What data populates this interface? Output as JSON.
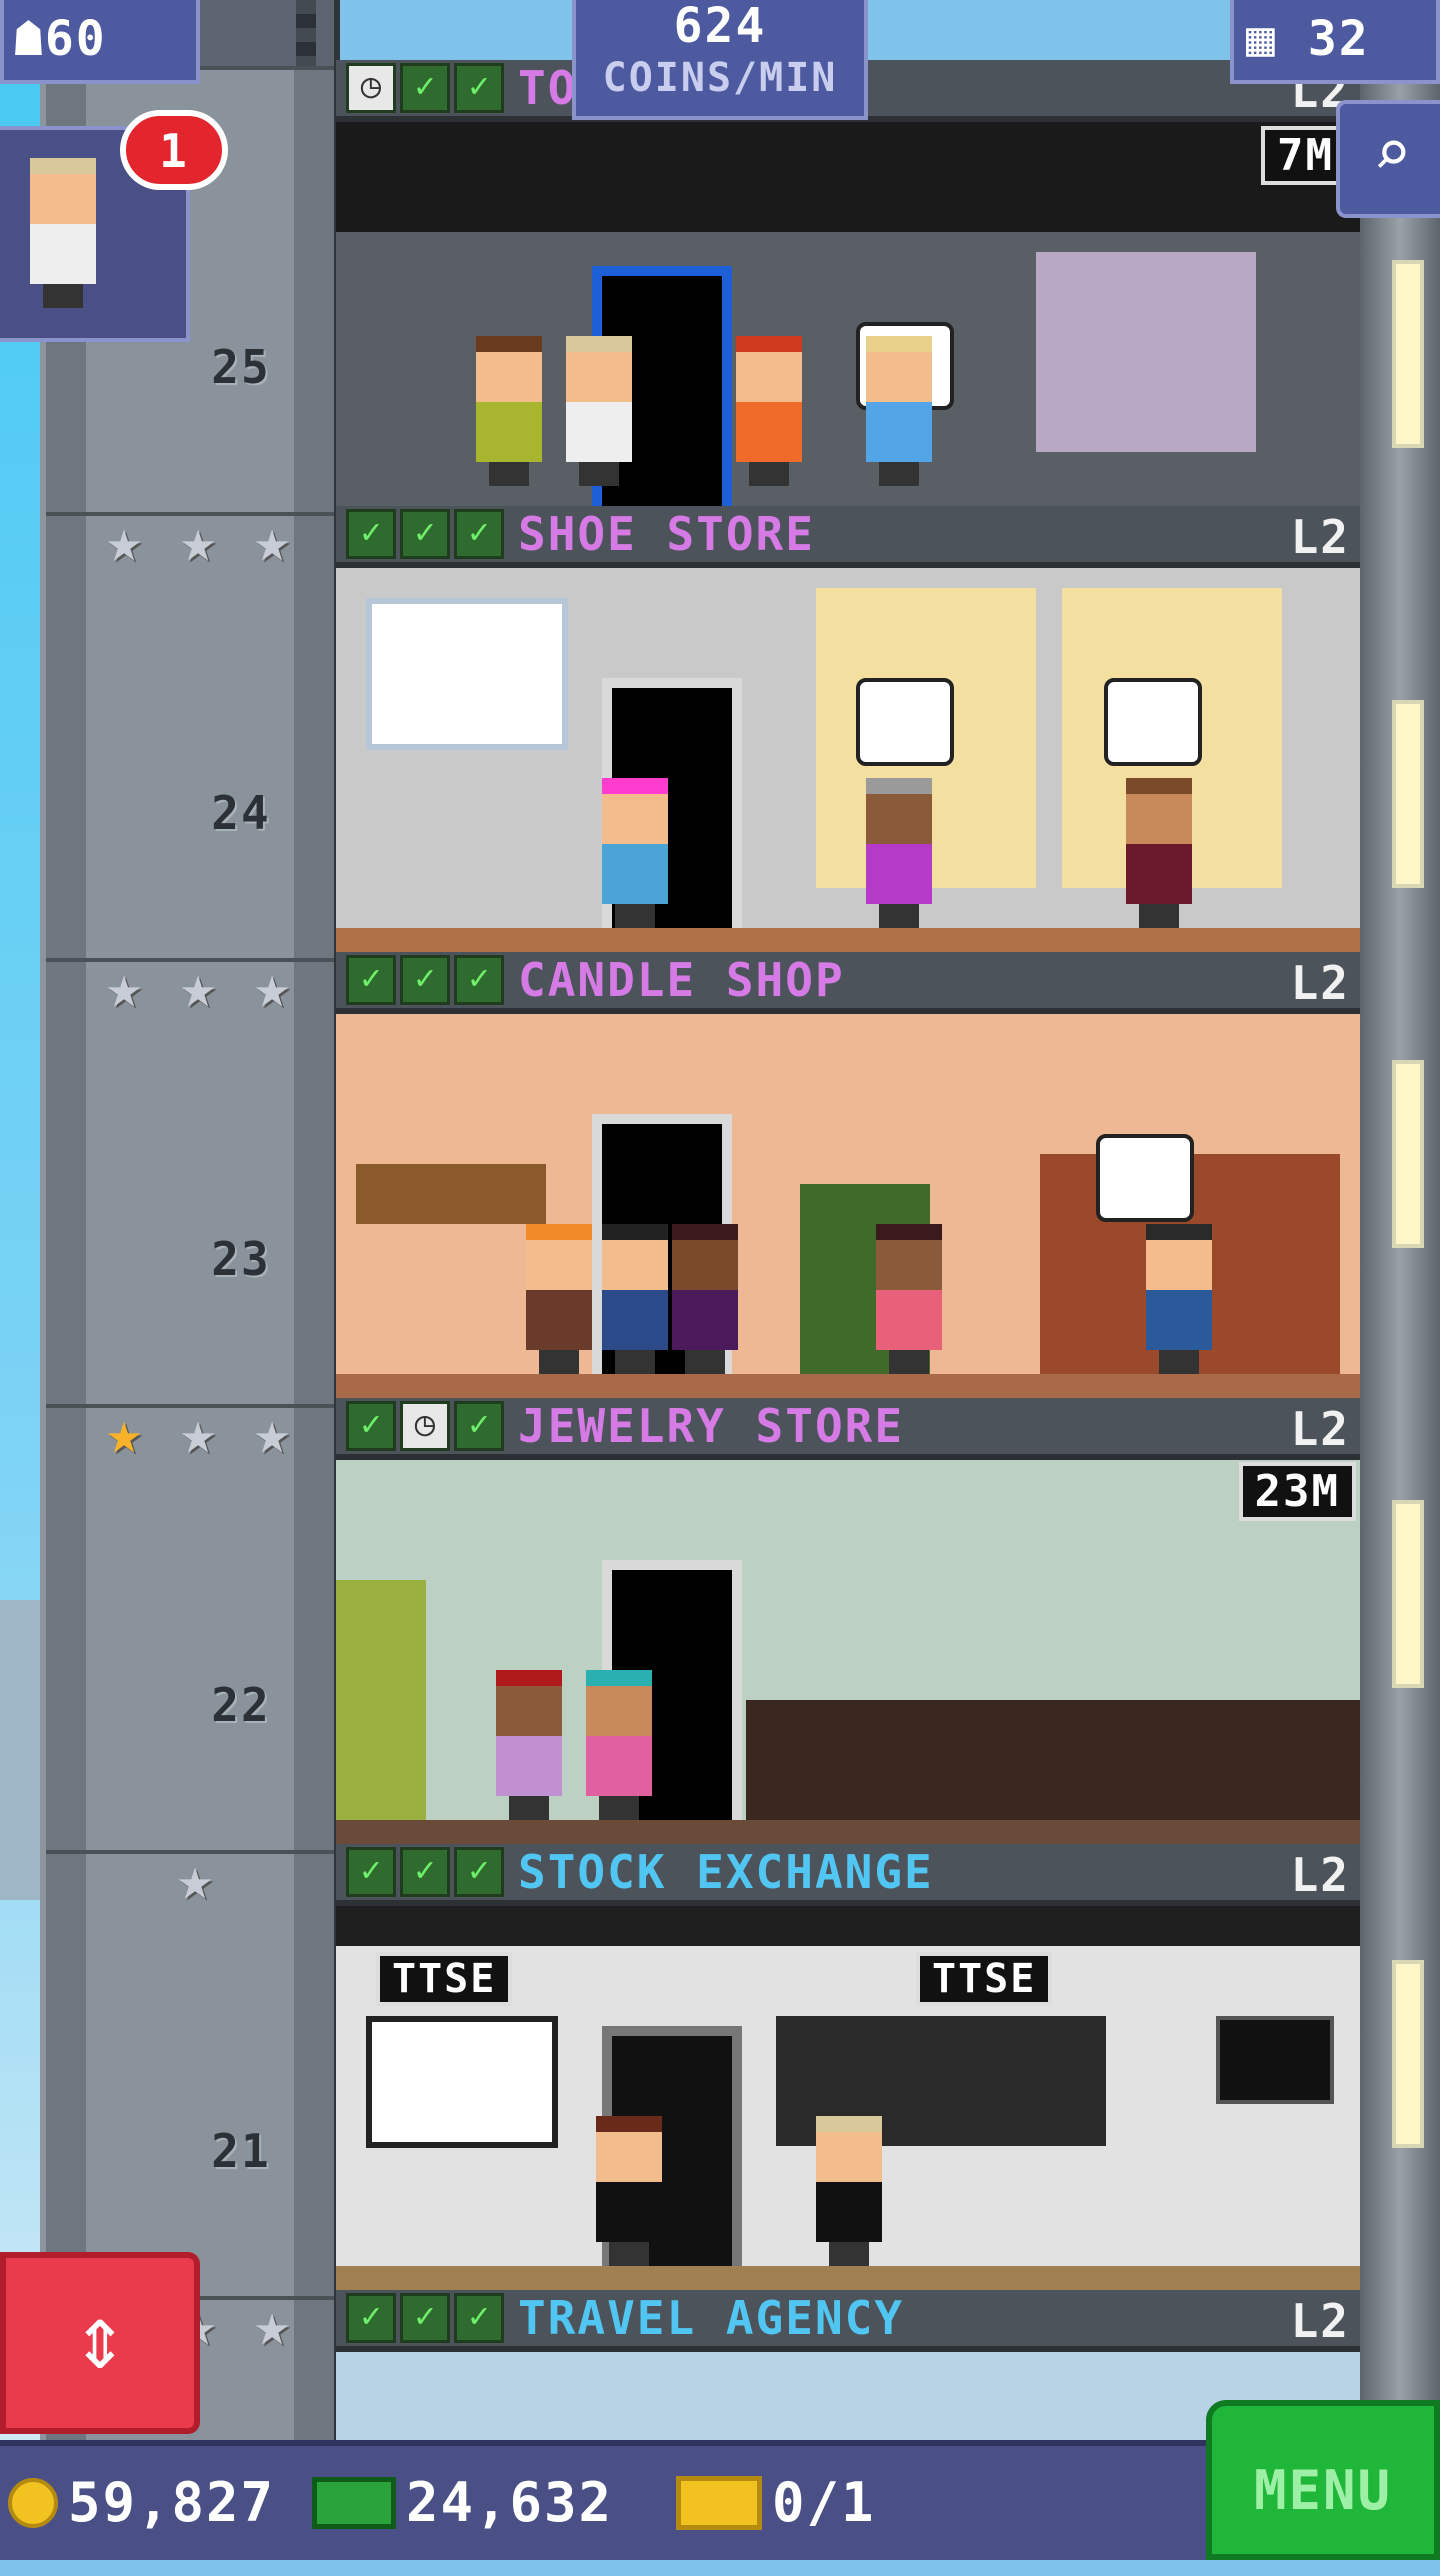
{
  "hud": {
    "population": "60",
    "coins_per_min_value": "624",
    "coins_per_min_label": "COINS/MIN",
    "floors": "32",
    "search_icon": "magnifier-icon"
  },
  "visitor": {
    "notification_count": "1"
  },
  "top_floor": {
    "name": "TO    AP",
    "level": "L2",
    "inventory_badge": "7M"
  },
  "floors": [
    {
      "number": "25",
      "name": "SHOE STORE",
      "level": "L2",
      "name_color": "#d67ae6",
      "stars": [
        "silver",
        "silver",
        "silver"
      ],
      "checks": [
        "check",
        "check",
        "check"
      ]
    },
    {
      "number": "24",
      "name": "CANDLE SHOP",
      "level": "L2",
      "name_color": "#d67ae6",
      "stars": [
        "silver",
        "silver",
        "silver"
      ],
      "checks": [
        "check",
        "check",
        "check"
      ]
    },
    {
      "number": "23",
      "name": "JEWELRY STORE",
      "level": "L2",
      "name_color": "#d67ae6",
      "stars": [
        "gold",
        "silver",
        "silver"
      ],
      "checks": [
        "check",
        "clock",
        "check"
      ],
      "inventory_badge": "23M"
    },
    {
      "number": "22",
      "name": "STOCK EXCHANGE",
      "level": "L2",
      "name_color": "#52c6f2",
      "stars": [
        "silver"
      ],
      "checks": [
        "check",
        "check",
        "check"
      ]
    },
    {
      "number": "21",
      "name": "TRAVEL AGENCY",
      "level": "L2",
      "name_color": "#52c6f2",
      "stars": [
        "silver",
        "silver",
        "silver"
      ],
      "checks": [
        "check",
        "check",
        "check"
      ]
    }
  ],
  "stock_exchange": {
    "sign_left": "TTSE",
    "sign_right": "TTSE"
  },
  "bottom_bar": {
    "coins": "59,827",
    "bux": "24,632",
    "tickets": "0/1",
    "menu_label": "MENU"
  },
  "colors": {
    "hud_panel": "#4d5aa0",
    "menu_green": "#1fb63a",
    "elevator_red": "#ea3b4c"
  }
}
